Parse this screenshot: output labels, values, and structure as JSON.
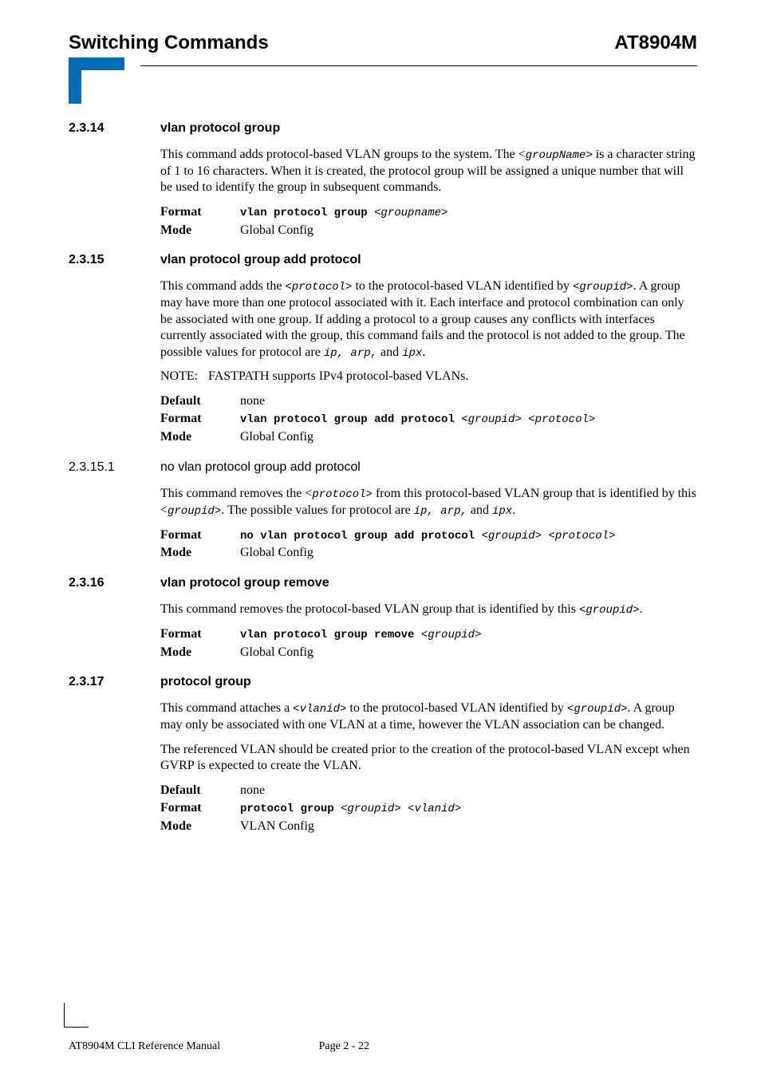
{
  "header": {
    "left": "Switching Commands",
    "right": "AT8904M"
  },
  "sections": {
    "s2314": {
      "num": "2.3.14",
      "title": "vlan protocol group",
      "para1_a": "This command adds protocol-based VLAN groups to the system. The <",
      "para1_code1": "groupName>",
      "para1_b": " is a character string of 1 to 16 characters.   When it is created, the protocol group will be assigned a unique number that will be used to identify the group in subsequent commands.",
      "format_label": "Format",
      "format_bold": "vlan protocol group ",
      "format_ital": "<groupname>",
      "mode_label": "Mode",
      "mode_val": "Global Config"
    },
    "s2315": {
      "num": "2.3.15",
      "title": "vlan protocol group add protocol",
      "p_a": "This command adds the ",
      "p_code1": "<protocol>",
      "p_b": " to the protocol-based VLAN identified by ",
      "p_code2": "<groupid>",
      "p_c": ". A group may have more than one protocol associated with it. Each interface and protocol combination can only be associated with one group. If adding a protocol to a group causes any conflicts with interfaces currently associated with the group, this command fails and the protocol is not added to the group. The possible values for protocol are ",
      "p_code3": "ip, arp,",
      "p_d": " and ",
      "p_code4": "ipx",
      "p_e": ".",
      "note_label": "NOTE:",
      "note_text": "FASTPATH supports IPv4 protocol-based VLANs.",
      "default_label": "Default",
      "default_val": "none",
      "format_label": "Format",
      "format_bold": "vlan protocol group add protocol ",
      "format_ital": "<groupid> <protocol>",
      "mode_label": "Mode",
      "mode_val": "Global Config"
    },
    "s23151": {
      "num": "2.3.15.1",
      "title": "no vlan protocol group add protocol",
      "p_a": "This command removes the <",
      "p_code1": "protocol>",
      "p_b": " from this protocol-based VLAN group that is identified by this <",
      "p_code2": "groupid>",
      "p_c": ". The possible values for protocol are ",
      "p_code3": "ip, arp,",
      "p_d": " and ",
      "p_code4": "ipx",
      "p_e": ".",
      "format_label": "Format",
      "format_bold": "no vlan protocol group add protocol ",
      "format_ital": "<groupid> <protocol>",
      "mode_label": "Mode",
      "mode_val": "Global Config"
    },
    "s2316": {
      "num": "2.3.16",
      "title": "vlan protocol group remove",
      "p_a": "This command removes the protocol-based VLAN group that is identified by this ",
      "p_code1": "<groupid>",
      "p_b": ".",
      "format_label": "Format",
      "format_bold": "vlan protocol group remove ",
      "format_ital": "<groupid>",
      "mode_label": "Mode",
      "mode_val": "Global Config"
    },
    "s2317": {
      "num": "2.3.17",
      "title": "protocol group",
      "p1_a": "This command attaches a ",
      "p1_code1": "<vlanid>",
      "p1_b": " to the protocol-based VLAN identified by ",
      "p1_code2": "<groupid>",
      "p1_c": ".   A group may only be associated with one VLAN at a time, however the VLAN association can be changed.",
      "p2": "The referenced VLAN should be created prior to the creation of the protocol-based VLAN except when GVRP is expected to create the VLAN.",
      "default_label": "Default",
      "default_val": "none",
      "format_label": "Format",
      "format_bold": "protocol group ",
      "format_ital": "<groupid> <vlanid>",
      "mode_label": "Mode",
      "mode_val": "VLAN Config"
    }
  },
  "footer": {
    "left": "AT8904M CLI Reference Manual",
    "page": "Page 2 - 22"
  }
}
